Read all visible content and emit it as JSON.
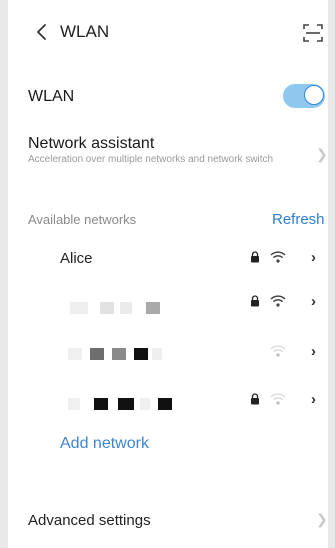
{
  "header": {
    "title": "WLAN",
    "back_icon": "chevron-left-icon",
    "scan_icon": "scan-frame-icon"
  },
  "wlan_toggle": {
    "label": "WLAN",
    "enabled": true,
    "accent": "#2f86d8"
  },
  "network_assistant": {
    "title": "Network assistant",
    "description": "Acceleration over multiple networks and network switch"
  },
  "available_networks": {
    "label": "Available networks",
    "refresh_label": "Refresh",
    "networks": [
      {
        "name": "Alice",
        "secured": true,
        "signal": "strong"
      },
      {
        "name": "",
        "name_obscured": true,
        "secured": true,
        "signal": "strong"
      },
      {
        "name": "",
        "name_obscured": true,
        "secured": false,
        "signal": "weak"
      },
      {
        "name": "",
        "name_obscured": true,
        "secured": true,
        "signal": "weak"
      }
    ]
  },
  "add_network_label": "Add network",
  "advanced_settings_label": "Advanced settings",
  "colors": {
    "link": "#2e7fd0",
    "muted": "#9a9a9a",
    "background": "#ffffff"
  }
}
